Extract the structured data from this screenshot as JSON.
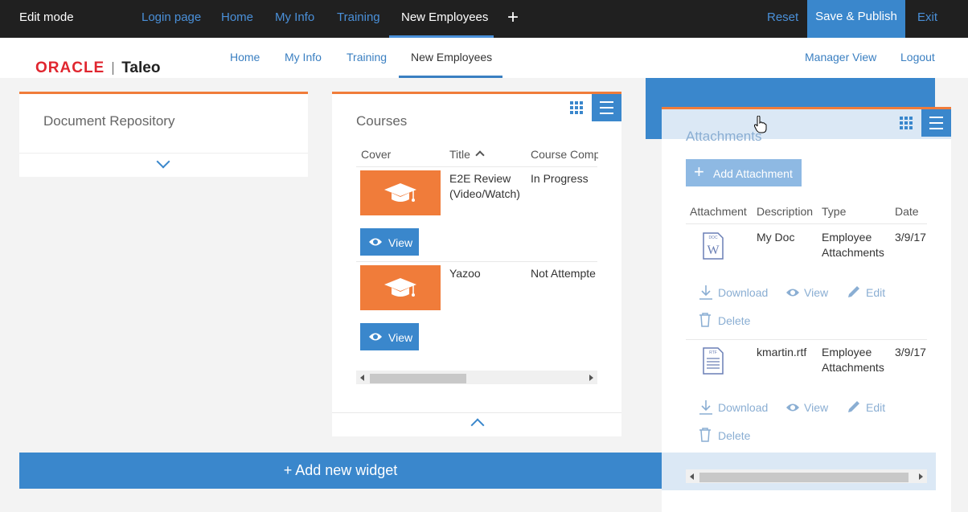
{
  "editbar": {
    "mode": "Edit mode",
    "links": [
      "Login page",
      "Home",
      "My Info",
      "Training"
    ],
    "active_tab": "New Employees",
    "add": "+",
    "reset": "Reset",
    "publish": "Save & Publish",
    "exit": "Exit"
  },
  "header": {
    "logo_oracle": "ORACLE",
    "logo_taleo": "Taleo",
    "nav": [
      "Home",
      "My Info",
      "Training"
    ],
    "active_nav": "New Employees",
    "manager_view": "Manager View",
    "logout": "Logout"
  },
  "doc_repo": {
    "title": "Document Repository"
  },
  "courses": {
    "title": "Courses",
    "columns": [
      "Cover",
      "Title",
      "Course Comp"
    ],
    "rows": [
      {
        "title_line1": "E2E Review",
        "title_line2": "(Video/Watch)",
        "status": "In Progress",
        "view": "View"
      },
      {
        "title_line1": "Yazoo",
        "title_line2": "",
        "status": "Not Attempte",
        "view": "View"
      }
    ]
  },
  "add_widget": "+ Add new widget",
  "attachments": {
    "title": "Attachments",
    "add_button": "Add Attachment",
    "columns": [
      "Attachment",
      "Description",
      "Type",
      "Date"
    ],
    "rows": [
      {
        "description": "My Doc",
        "type_line1": "Employee",
        "type_line2": "Attachments",
        "date": "3/9/17",
        "icon_label": "DOC"
      },
      {
        "description": "kmartin.rtf",
        "type_line1": "Employee",
        "type_line2": "Attachments",
        "date": "3/9/17",
        "icon_label": "RTF"
      }
    ],
    "actions": {
      "download": "Download",
      "view": "View",
      "edit": "Edit",
      "delete": "Delete"
    }
  },
  "colors": {
    "accent": "#3a87cc",
    "orange": "#f07c3a",
    "oracle_red": "#e0262f"
  }
}
